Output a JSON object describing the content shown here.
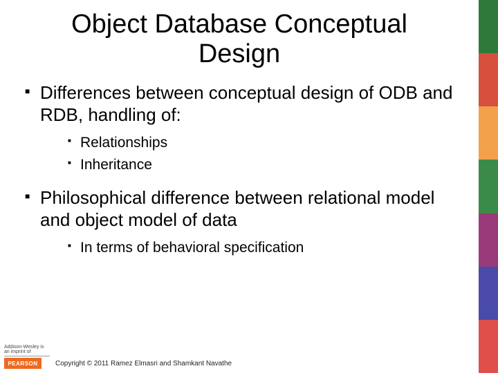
{
  "title": "Object Database Conceptual Design",
  "bullets": [
    {
      "text": "Differences between conceptual design of ODB and RDB, handling of:",
      "children": [
        {
          "text": "Relationships"
        },
        {
          "text": "Inheritance"
        }
      ]
    },
    {
      "text": "Philosophical difference between relational model and object model of data",
      "children": [
        {
          "text": "In terms of behavioral specification"
        }
      ]
    }
  ],
  "logo": {
    "imprint": "Addison-Wesley is an imprint of",
    "brand": "PEARSON"
  },
  "copyright": "Copyright © 2011 Ramez Elmasri and Shamkant Navathe"
}
